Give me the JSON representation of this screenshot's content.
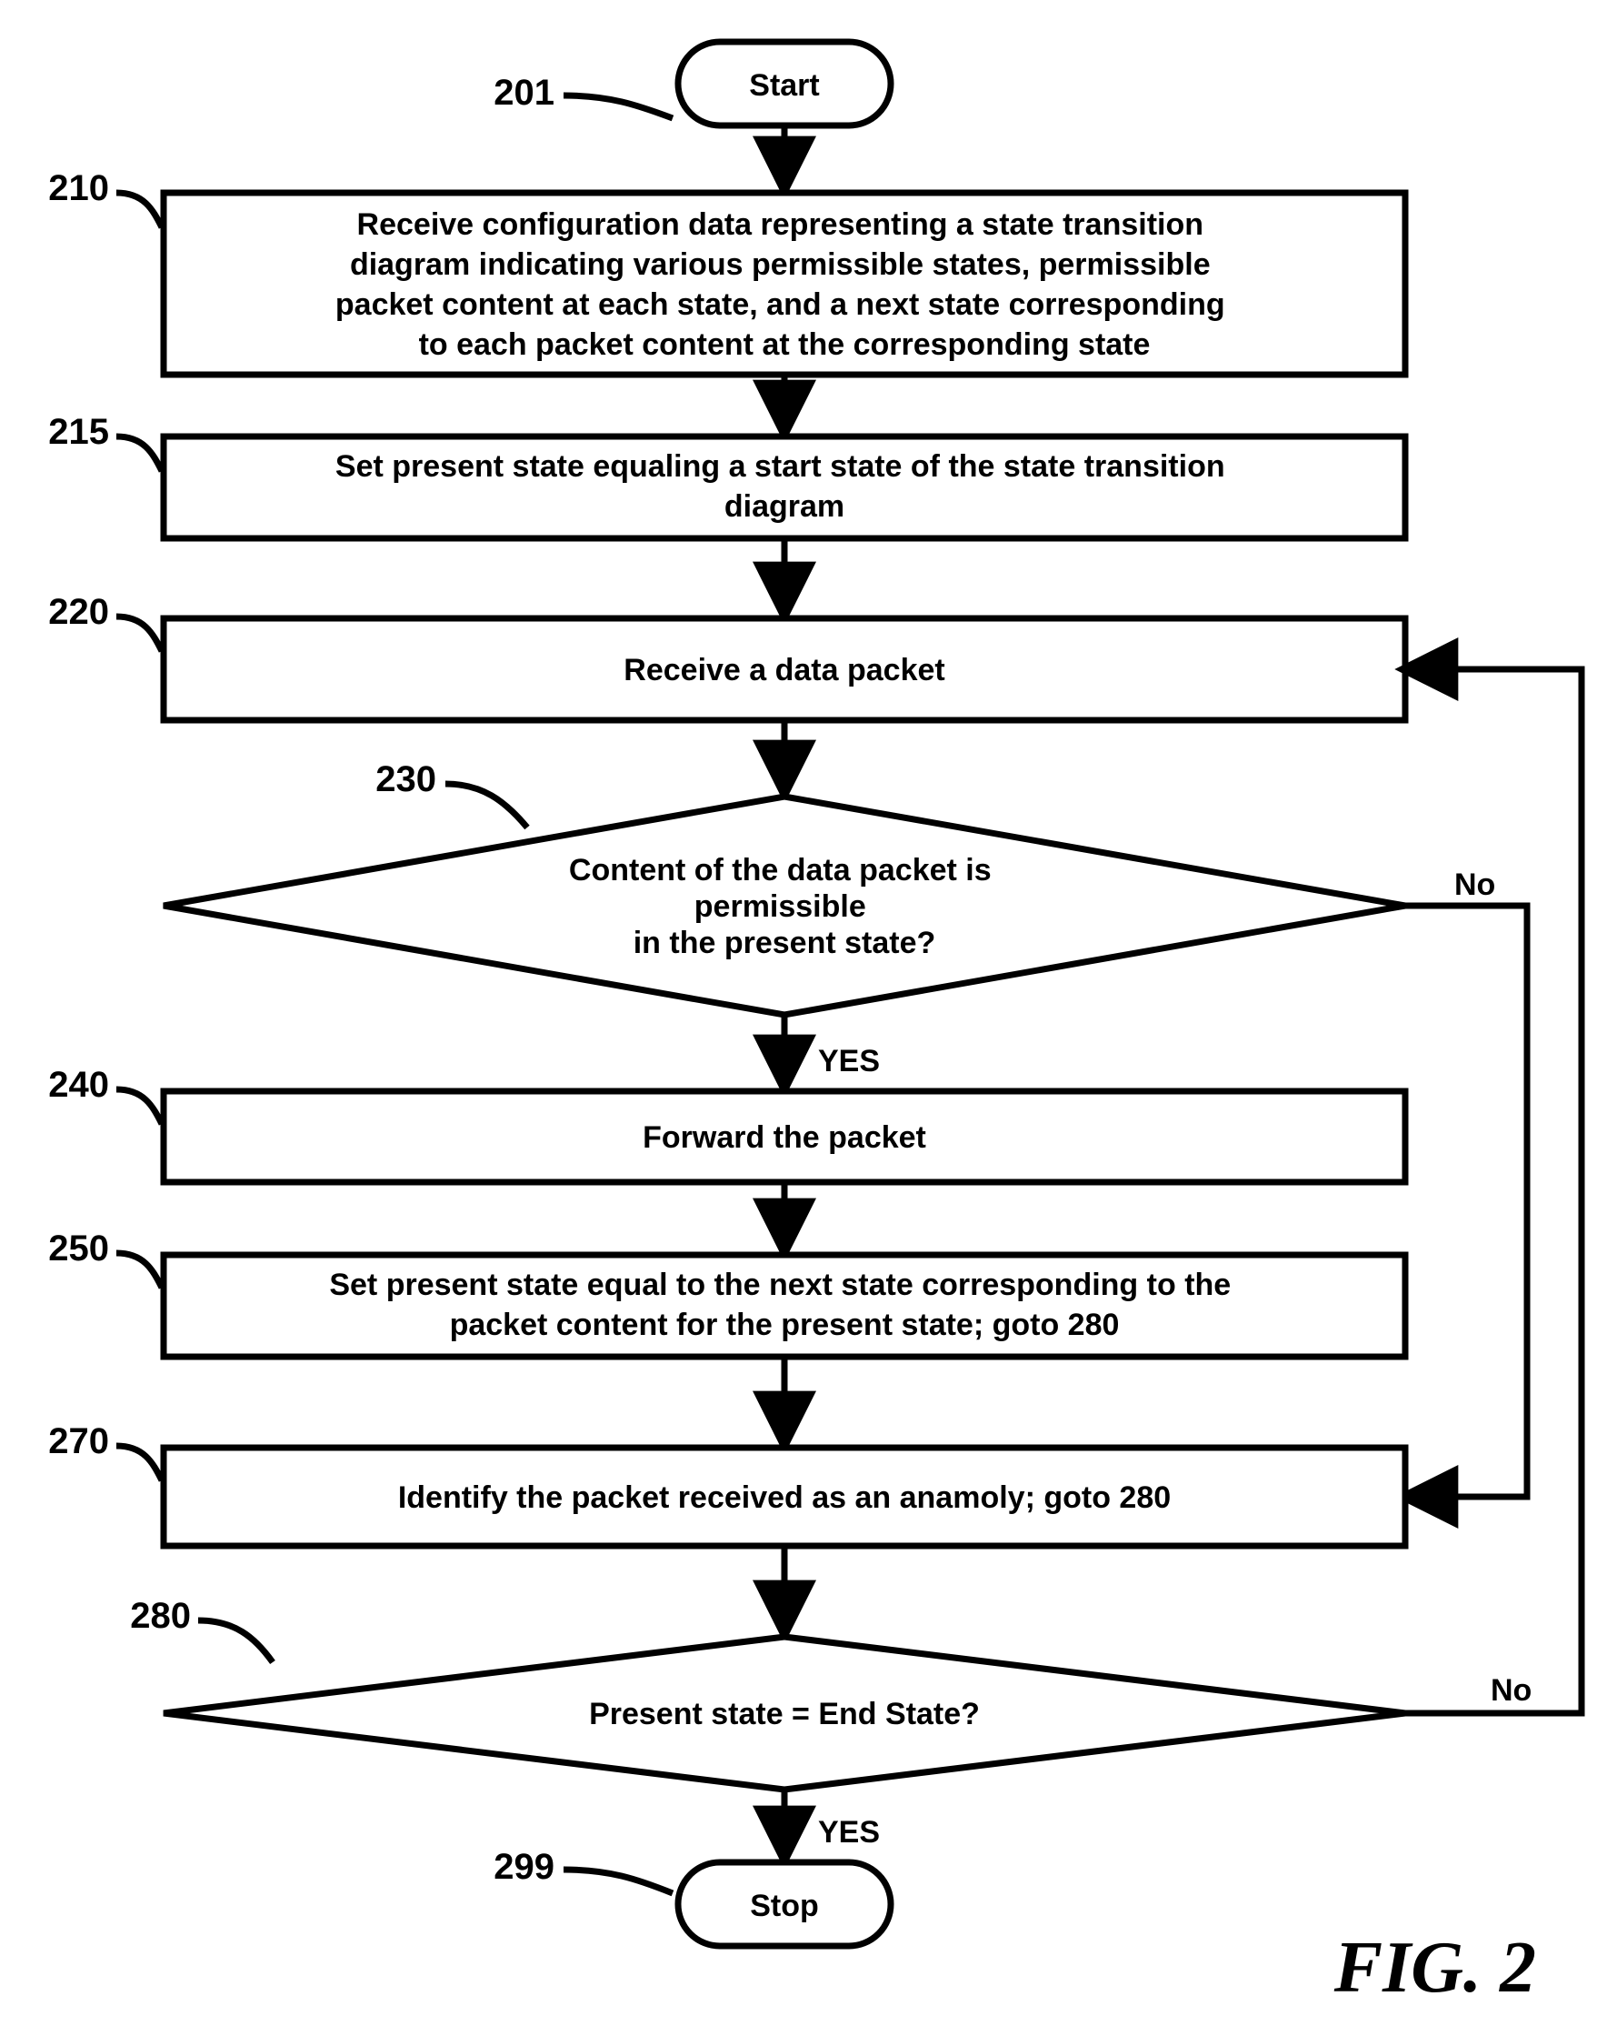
{
  "figure_label": "FIG. 2",
  "nodes": {
    "start": {
      "ref": "201",
      "text": "Start"
    },
    "n210": {
      "ref": "210",
      "lines": [
        "Receive configuration data representing a state transition",
        "diagram indicating various permissible states, permissible",
        "packet content at each state, and a next state corresponding",
        "to each packet content at the corresponding state"
      ]
    },
    "n215": {
      "ref": "215",
      "lines": [
        "Set present state equaling a start state of the state transition",
        "diagram"
      ]
    },
    "n220": {
      "ref": "220",
      "lines": [
        "Receive a data packet"
      ]
    },
    "d230": {
      "ref": "230",
      "lines": [
        "Content of the data packet is",
        "permissible",
        "in the present state?"
      ],
      "yes": "YES",
      "no": "No"
    },
    "n240": {
      "ref": "240",
      "lines": [
        "Forward the packet"
      ]
    },
    "n250": {
      "ref": "250",
      "lines": [
        "Set present state equal to the next state corresponding to the",
        "packet content for the present state; goto 280"
      ]
    },
    "n270": {
      "ref": "270",
      "lines": [
        "Identify the packet received as an anamoly; goto 280"
      ]
    },
    "d280": {
      "ref": "280",
      "lines": [
        "Present state = End State?"
      ],
      "yes": "YES",
      "no": "No"
    },
    "stop": {
      "ref": "299",
      "text": "Stop"
    }
  }
}
